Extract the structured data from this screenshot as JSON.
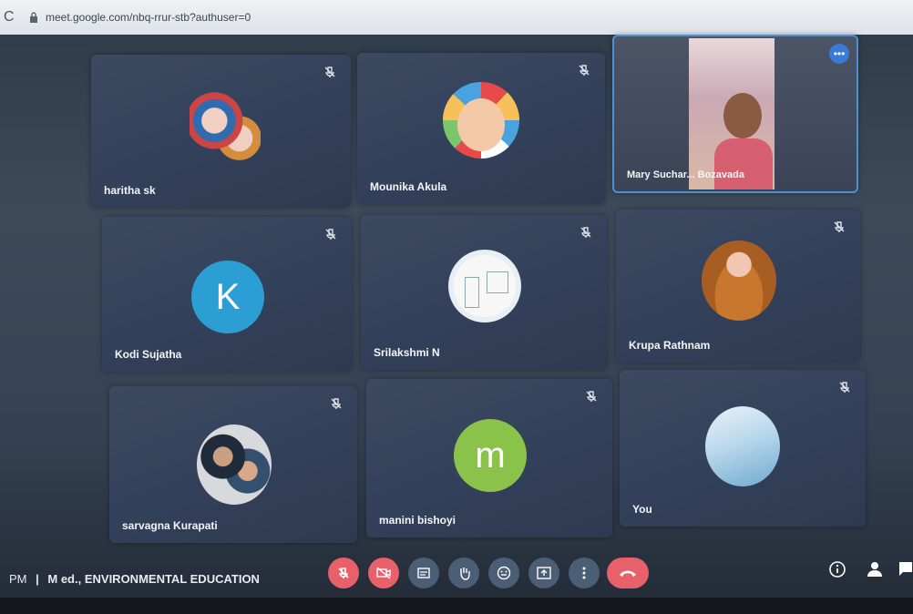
{
  "browser": {
    "reload_icon": "reload-icon",
    "url": "meet.google.com/nbq-rrur-stb?authuser=0"
  },
  "participants": [
    {
      "name": "haritha sk",
      "avatar": "deity-image",
      "muted": true
    },
    {
      "name": "Mounika Akula",
      "avatar": "baby-photo",
      "muted": true
    },
    {
      "name": "Mary Suchar... Bozavada",
      "avatar": "video-feed",
      "muted": false,
      "active": true
    },
    {
      "name": "Kodi Sujatha",
      "avatar_letter": "K",
      "avatar_color": "#2b9fd4",
      "muted": true
    },
    {
      "name": "Srilakshmi N",
      "avatar": "sketch-image",
      "muted": true
    },
    {
      "name": "Krupa Rathnam",
      "avatar": "baby-photo",
      "muted": true
    },
    {
      "name": "sarvagna Kurapati",
      "avatar": "couple-photo",
      "muted": true
    },
    {
      "name": "manini bishoyi",
      "avatar_letter": "m",
      "avatar_color": "#8bc34a",
      "muted": true
    },
    {
      "name": "You",
      "avatar": "water-image",
      "muted": true
    }
  ],
  "meeting": {
    "time": "PM",
    "separator": "|",
    "title": "M ed., ENVIRONMENTAL EDUCATION"
  },
  "controls": [
    {
      "name": "mic-off-button",
      "icon": "mic-off-icon",
      "color": "#e8616a"
    },
    {
      "name": "camera-off-button",
      "icon": "camera-off-icon",
      "color": "#e8616a"
    },
    {
      "name": "captions-button",
      "icon": "captions-icon",
      "color": "#4c5e75"
    },
    {
      "name": "raise-hand-button",
      "icon": "hand-icon",
      "color": "#4c5e75"
    },
    {
      "name": "reactions-button",
      "icon": "emoji-icon",
      "color": "#4c5e75"
    },
    {
      "name": "present-button",
      "icon": "present-icon",
      "color": "#4c5e75"
    },
    {
      "name": "more-options-button",
      "icon": "more-vert-icon",
      "color": "#4c5e75"
    },
    {
      "name": "leave-call-button",
      "icon": "phone-end-icon",
      "color": "#e8616a"
    }
  ],
  "more_label": "•••"
}
